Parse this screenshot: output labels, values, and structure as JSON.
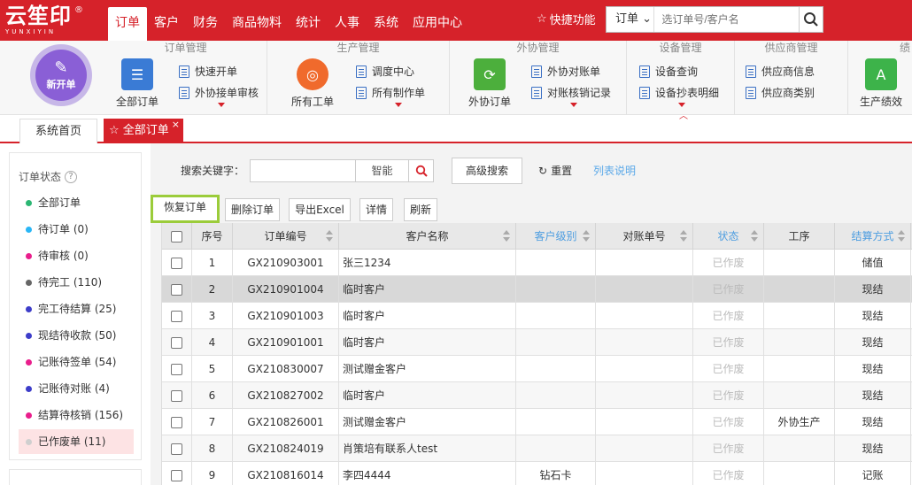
{
  "logo": {
    "cn": "云笙印",
    "en": "YUNXIYIN",
    "reg": "®"
  },
  "nav": [
    "订单",
    "客户",
    "财务",
    "商品物料",
    "统计",
    "人事",
    "系统",
    "应用中心"
  ],
  "quick": "快捷功能",
  "search": {
    "select": "订单",
    "placeholder": "选订单号/客户名"
  },
  "ribbon": {
    "new_order": "新开单",
    "groups": {
      "order": {
        "title": "订单管理",
        "big": "全部订单",
        "items": [
          "快速开单",
          "外协接单审核"
        ]
      },
      "production": {
        "title": "生产管理",
        "big": "所有工单",
        "items": [
          "调度中心",
          "所有制作单"
        ]
      },
      "outsource": {
        "title": "外协管理",
        "big": "外协订单",
        "items": [
          "外协对账单",
          "对账核销记录"
        ]
      },
      "equipment": {
        "title": "设备管理",
        "items": [
          "设备查询",
          "设备抄表明细"
        ]
      },
      "supplier": {
        "title": "供应商管理",
        "items": [
          "供应商信息",
          "供应商类别"
        ]
      },
      "perf": {
        "title": "绩",
        "big": "生产绩效"
      }
    }
  },
  "tabs": {
    "home": "系统首页",
    "current": "全部订单",
    "close": "×"
  },
  "sidebar": {
    "title": "订单状态",
    "items": [
      {
        "label": "全部订单",
        "color": "#2bb673"
      },
      {
        "label": "待订单 (0)",
        "color": "#29b6f6"
      },
      {
        "label": "待审核 (0)",
        "color": "#e91e8c"
      },
      {
        "label": "待完工 (110)",
        "color": "#666666"
      },
      {
        "label": "完工待结算 (25)",
        "color": "#3d3dc9"
      },
      {
        "label": "现结待收款 (50)",
        "color": "#3d3dc9"
      },
      {
        "label": "记账待签单 (54)",
        "color": "#e91e8c"
      },
      {
        "label": "记账待对账 (4)",
        "color": "#3d3dc9"
      },
      {
        "label": "结算待核销 (156)",
        "color": "#e91e8c"
      },
      {
        "label": "已作废单 (11)",
        "color": "#cfcfcf"
      }
    ]
  },
  "toolbar": {
    "keyword_label": "搜索关键字：",
    "smart": "智能",
    "advanced": "高级搜索",
    "reset": "重置",
    "col_desc": "列表说明",
    "actions": [
      "恢复订单",
      "删除订单",
      "导出Excel",
      "详情",
      "刷新"
    ]
  },
  "table": {
    "headers": [
      "序号",
      "订单编号",
      "客户名称",
      "客户级别",
      "对账单号",
      "状态",
      "工序",
      "结算方式"
    ],
    "rows": [
      [
        "1",
        "GX210903001",
        "张三1234",
        "",
        "",
        "已作废",
        "",
        "储值"
      ],
      [
        "2",
        "GX210901004",
        "临时客户",
        "",
        "",
        "已作废",
        "",
        "现结"
      ],
      [
        "3",
        "GX210901003",
        "临时客户",
        "",
        "",
        "已作废",
        "",
        "现结"
      ],
      [
        "4",
        "GX210901001",
        "临时客户",
        "",
        "",
        "已作废",
        "",
        "现结"
      ],
      [
        "5",
        "GX210830007",
        "测试赠金客户",
        "",
        "",
        "已作废",
        "",
        "现结"
      ],
      [
        "6",
        "GX210827002",
        "临时客户",
        "",
        "",
        "已作废",
        "",
        "现结"
      ],
      [
        "7",
        "GX210826001",
        "测试赠金客户",
        "",
        "",
        "已作废",
        "外协生产",
        "现结"
      ],
      [
        "8",
        "GX210824019",
        "肖策培有联系人test",
        "",
        "",
        "已作废",
        "",
        "现结"
      ],
      [
        "9",
        "GX210816014",
        "李四4444",
        "钻石卡",
        "",
        "已作废",
        "",
        "记账"
      ]
    ]
  }
}
